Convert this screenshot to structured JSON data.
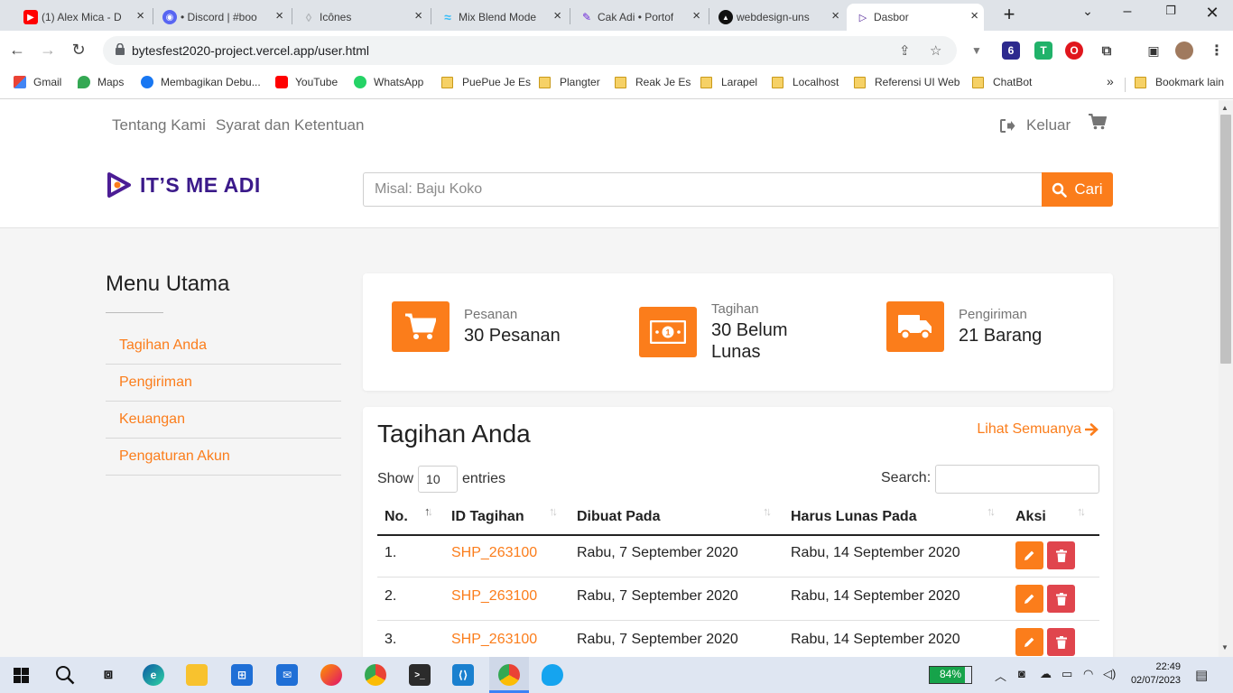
{
  "browser": {
    "tabs": [
      {
        "title": "(1) Alex Mica - D",
        "favicon": "youtube-icon",
        "color": "#ff0000"
      },
      {
        "title": "• Discord | #boo",
        "favicon": "discord-icon",
        "color": "#5865f2"
      },
      {
        "title": "Icônes",
        "favicon": "icones-icon",
        "color": "#c0c4c8"
      },
      {
        "title": "Mix Blend Mode",
        "favicon": "tailwind-icon",
        "color": "#38bdf8"
      },
      {
        "title": "Cak Adi • Portof",
        "favicon": "cak-adi-icon",
        "color": "#6d28d9"
      },
      {
        "title": "webdesign-uns",
        "favicon": "vercel-icon",
        "color": "#111111"
      },
      {
        "title": "Dasbor",
        "favicon": "play-logo-icon",
        "color": "#4c1d95"
      }
    ],
    "url": "bytesfest2020-project.vercel.app/user.html",
    "bookmarks": [
      {
        "label": "Gmail",
        "type": "gmail"
      },
      {
        "label": "Maps",
        "type": "maps"
      },
      {
        "label": "Membagikan Debu...",
        "type": "facebook"
      },
      {
        "label": "YouTube",
        "type": "youtube"
      },
      {
        "label": "WhatsApp",
        "type": "whatsapp"
      },
      {
        "label": "PuePue Je Es",
        "type": "folder"
      },
      {
        "label": "Plangter",
        "type": "folder"
      },
      {
        "label": "Reak Je Es",
        "type": "folder"
      },
      {
        "label": "Larapel",
        "type": "folder"
      },
      {
        "label": "Localhost",
        "type": "folder"
      },
      {
        "label": "Referensi UI Web",
        "type": "folder"
      },
      {
        "label": "ChatBot",
        "type": "folder"
      }
    ],
    "bookmarks_more": "»",
    "other_bookmarks": "Bookmark lain"
  },
  "site": {
    "nav": {
      "about": "Tentang Kami",
      "terms": "Syarat dan Ketentuan",
      "logout": "Keluar"
    },
    "logo": "IT’S ME ADI",
    "search": {
      "placeholder": "Misal: Baju Koko",
      "button": "Cari"
    },
    "accent": "#fb7d1b"
  },
  "sidebar": {
    "title": "Menu Utama",
    "items": [
      "Tagihan Anda",
      "Pengiriman",
      "Keuangan",
      "Pengaturan Akun"
    ]
  },
  "stats": [
    {
      "label": "Pesanan",
      "value": "30 Pesanan",
      "icon": "cart-icon"
    },
    {
      "label": "Tagihan",
      "value_line1": "30 Belum",
      "value_line2": "Lunas",
      "icon": "money-icon"
    },
    {
      "label": "Pengiriman",
      "value": "21 Barang",
      "icon": "truck-icon"
    }
  ],
  "bills": {
    "title": "Tagihan Anda",
    "see_all": "Lihat Semuanya",
    "show_label": "Show",
    "entries_value": "10",
    "entries_label": "entries",
    "search_label": "Search:",
    "columns": [
      "No.",
      "ID Tagihan",
      "Dibuat Pada",
      "Harus Lunas Pada",
      "Aksi"
    ],
    "rows": [
      {
        "no": "1.",
        "id": "SHP_263100",
        "created": "Rabu, 7 September 2020",
        "due": "Rabu, 14 September 2020"
      },
      {
        "no": "2.",
        "id": "SHP_263100",
        "created": "Rabu, 7 September 2020",
        "due": "Rabu, 14 September 2020"
      },
      {
        "no": "3.",
        "id": "SHP_263100",
        "created": "Rabu, 7 September 2020",
        "due": "Rabu, 14 September 2020"
      }
    ]
  },
  "taskbar": {
    "battery": "84%",
    "battery_level": 0.84,
    "time": "22:49",
    "date": "02/07/2023"
  }
}
